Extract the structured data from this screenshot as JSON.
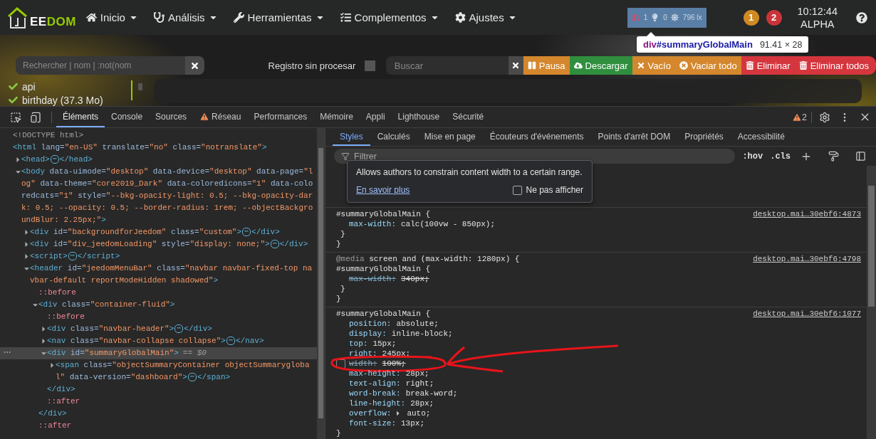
{
  "app": {
    "navbar": {
      "logo": {
        "light": "EE",
        "accent": "DOM"
      },
      "menus": [
        {
          "label": "Inicio"
        },
        {
          "label": "Análisis"
        },
        {
          "label": "Herramientas"
        },
        {
          "label": "Complementos"
        },
        {
          "label": "Ajustes"
        }
      ],
      "summary": [
        {
          "value": "1"
        },
        {
          "value": "0"
        },
        {
          "value": "796 lx"
        }
      ],
      "badges": [
        {
          "text": "1",
          "color": "#d08a23"
        },
        {
          "text": "2",
          "color": "#c9343a"
        }
      ],
      "clock": {
        "time": "10:12:44",
        "name": "ALPHA"
      }
    },
    "inspect_tooltip": {
      "tag": "div",
      "id": "#summaryGlobalMain",
      "size": "91.41 × 28"
    },
    "log_toolbar": {
      "search": {
        "placeholder": "Rechercher | nom | :not(nom"
      },
      "raw_log": {
        "label": "Registro sin procesar",
        "checked": false
      },
      "filter": {
        "placeholder": "Buscar"
      },
      "buttons": [
        {
          "label": "Pausa",
          "color": "#d4872d"
        },
        {
          "label": "Descargar",
          "color": "#2f8f3e"
        },
        {
          "label": "Vacío",
          "color": "#d4872d"
        },
        {
          "label": "Vaciar todo",
          "color": "#d4872d"
        },
        {
          "label": "Eliminar",
          "color": "#d5363e"
        },
        {
          "label": "Eliminar todos",
          "color": "#d5363e"
        }
      ]
    },
    "logs": [
      {
        "name": "api"
      },
      {
        "name": "birthday (37.3 Mo)"
      }
    ]
  },
  "devtools": {
    "tabs": [
      {
        "label": "Éléments",
        "selected": true,
        "warning": false
      },
      {
        "label": "Console",
        "selected": false,
        "warning": false
      },
      {
        "label": "Sources",
        "selected": false,
        "warning": false
      },
      {
        "label": "Réseau",
        "selected": false,
        "warning": true
      },
      {
        "label": "Performances",
        "selected": false,
        "warning": false
      },
      {
        "label": "Mémoire",
        "selected": false,
        "warning": false
      },
      {
        "label": "Appli",
        "selected": false,
        "warning": false
      },
      {
        "label": "Lighthouse",
        "selected": false,
        "warning": false
      },
      {
        "label": "Sécurité",
        "selected": false,
        "warning": false
      }
    ],
    "issues": "2",
    "dom": [
      {
        "kind": "doctype",
        "text": "<!DOCTYPE html>",
        "selected": false
      },
      {
        "kind": "element",
        "text": "<html lang=\"en-US\" translate=\"no\" class=\"notranslate\">",
        "selected": false,
        "children": [
          {
            "kind": "element",
            "text": "<head>",
            "hidden": "⋯",
            "close": "</head>",
            "expanded": false,
            "selected": false
          },
          {
            "kind": "element",
            "text": "<body data-uimode=\"desktop\" data-device=\"desktop\" data-page=\"log\" data-theme=\"core2019_Dark\" data-coloredicons=\"1\" data-coloredcats=\"1\" style=\"--bkg-opacity-light: 0.5; --bkg-opacity-dark: 0.5; --opacity: 0.5; --border-radius: 1rem; --objectBackgroundBlur: 2.25px;\">",
            "expanded": true,
            "selected": false,
            "children": [
              {
                "kind": "element",
                "text": "<div id=\"backgroundforJeedom\" class=\"custom\">",
                "hidden": "⋯",
                "close": "</div>",
                "expanded": false,
                "selected": false
              },
              {
                "kind": "element",
                "text": "<div id=\"div_jeedomLoading\" style=\"display: none;\">",
                "hidden": "⋯",
                "close": "</div>",
                "expanded": false,
                "selected": false
              },
              {
                "kind": "element",
                "text": "<script>",
                "hidden": "⋯",
                "close": "</script>",
                "expanded": false,
                "selected": false
              },
              {
                "kind": "element",
                "text": "<header id=\"jeedomMenuBar\" class=\"navbar navbar-fixed-top navbar-default reportModeHidden shadowed\">",
                "expanded": true,
                "selected": false,
                "children": [
                  {
                    "kind": "pseudo",
                    "text": "::before",
                    "selected": false
                  },
                  {
                    "kind": "element",
                    "text": "<div class=\"container-fluid\">",
                    "close": "</div>",
                    "expanded": true,
                    "selected": false,
                    "children": [
                      {
                        "kind": "pseudo",
                        "text": "::before",
                        "selected": false
                      },
                      {
                        "kind": "element",
                        "text": "<div class=\"navbar-header\">",
                        "hidden": "⋯",
                        "close": "</div>",
                        "expanded": false,
                        "selected": false
                      },
                      {
                        "kind": "element",
                        "text": "<nav class=\"navbar-collapse collapse\">",
                        "hidden": "⋯",
                        "close": "</nav>",
                        "expanded": false,
                        "selected": false
                      },
                      {
                        "kind": "element",
                        "text": "<div id=\"summaryGlobalMain\">",
                        "close": "</div>",
                        "suffix": "== $0",
                        "expanded": true,
                        "selected": true,
                        "children": [
                          {
                            "kind": "element",
                            "text": "<span class=\"objectSummaryContainer objectSummaryglobal\" data-version=\"dashboard\">",
                            "hidden": "⋯",
                            "close": "</span>",
                            "expanded": false,
                            "selected": false
                          }
                        ]
                      },
                      {
                        "kind": "pseudo",
                        "text": "::after",
                        "selected": false
                      }
                    ]
                  },
                  {
                    "kind": "pseudo",
                    "text": "::after",
                    "selected": false
                  }
                ]
              }
            ]
          }
        ]
      }
    ],
    "styles": {
      "tabs": [
        {
          "label": "Styles",
          "selected": true
        },
        {
          "label": "Calculés",
          "selected": false
        },
        {
          "label": "Mise en page",
          "selected": false
        },
        {
          "label": "Écouteurs d'événements",
          "selected": false
        },
        {
          "label": "Points d'arrêt DOM",
          "selected": false
        },
        {
          "label": "Propriétés",
          "selected": false
        },
        {
          "label": "Accessibilité",
          "selected": false
        }
      ],
      "filter": {
        "placeholder": "Filtrer"
      },
      "toggles": [
        ":hov",
        ".cls"
      ],
      "popover": {
        "text": "Allows authors to constrain content width to a certain range.",
        "link": "En savoir plus",
        "dismiss": {
          "label": "Ne pas afficher",
          "checked": false
        }
      },
      "rules": [
        {
          "selector": "#summaryGlobalMain {",
          "source": "desktop.mai…30ebf6:4873",
          "declarations": [
            {
              "name": "max-width:",
              "value": "calc(100vw - 850px);",
              "enabled": true,
              "overridden": false,
              "annotated": false
            }
          ],
          "closing": [
            "}",
            "}"
          ]
        },
        {
          "media": {
            "keyword": "@media",
            "query": "screen and (max-width: 1280px) {"
          },
          "selector": "#summaryGlobalMain {",
          "source": "desktop.mai…30ebf6:4798",
          "declarations": [
            {
              "name": "max-width:",
              "value": "340px;",
              "enabled": true,
              "overridden": true,
              "annotated": false
            }
          ],
          "closing": [
            "}",
            "}"
          ]
        },
        {
          "selector": "#summaryGlobalMain {",
          "source": "desktop.mai…30ebf6:1077",
          "declarations": [
            {
              "name": "position:",
              "value": "absolute;",
              "enabled": true,
              "overridden": false,
              "annotated": false
            },
            {
              "name": "display:",
              "value": "inline-block;",
              "enabled": true,
              "overridden": false,
              "annotated": false
            },
            {
              "name": "top:",
              "value": "15px;",
              "enabled": true,
              "overridden": false,
              "annotated": false
            },
            {
              "name": "right:",
              "value": "245px;",
              "enabled": true,
              "overridden": false,
              "annotated": false
            },
            {
              "name": "width:",
              "value": "100%;",
              "enabled": false,
              "overridden": false,
              "annotated": true
            },
            {
              "name": "max-height:",
              "value": "28px;",
              "enabled": true,
              "overridden": false,
              "annotated": false
            },
            {
              "name": "text-align:",
              "value": "right;",
              "enabled": true,
              "overridden": false,
              "annotated": false
            },
            {
              "name": "word-break:",
              "value": "break-word;",
              "enabled": true,
              "overridden": false,
              "annotated": false
            },
            {
              "name": "line-height:",
              "value": "28px;",
              "enabled": true,
              "overridden": false,
              "annotated": false
            },
            {
              "name": "overflow:",
              "value": "auto;",
              "kind": "expandable",
              "enabled": true,
              "overridden": false,
              "annotated": false
            },
            {
              "name": "font-size:",
              "value": "13px;",
              "enabled": true,
              "overridden": false,
              "annotated": false
            }
          ],
          "closing": [
            "}"
          ]
        }
      ]
    }
  }
}
